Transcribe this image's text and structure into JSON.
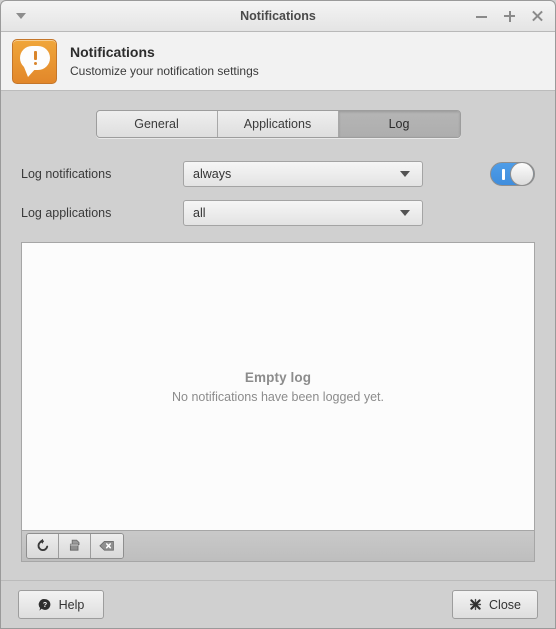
{
  "window": {
    "title": "Notifications",
    "menu_icon": "chevron-down-icon",
    "controls": {
      "minimize": "minimize-icon",
      "maximize": "maximize-icon",
      "close": "close-icon"
    }
  },
  "header": {
    "icon": "notification-bubble-icon",
    "title": "Notifications",
    "subtitle": "Customize your notification settings"
  },
  "tabs": [
    {
      "label": "General",
      "active": false
    },
    {
      "label": "Applications",
      "active": false
    },
    {
      "label": "Log",
      "active": true
    }
  ],
  "form": {
    "rows": [
      {
        "label": "Log notifications",
        "value": "always"
      },
      {
        "label": "Log applications",
        "value": "all"
      }
    ],
    "toggle": {
      "name": "log-enabled-toggle",
      "state": "on"
    }
  },
  "log": {
    "empty_title": "Empty log",
    "empty_subtitle": "No notifications have been logged yet.",
    "toolbar": [
      {
        "name": "refresh-button",
        "icon": "refresh-icon"
      },
      {
        "name": "copy-button",
        "icon": "copy-icon"
      },
      {
        "name": "clear-button",
        "icon": "backspace-clear-icon"
      }
    ]
  },
  "footer": {
    "help_label": "Help",
    "help_icon": "help-icon",
    "close_label": "Close",
    "close_icon": "close-x-icon"
  },
  "colors": {
    "accent": "#3f8ddd",
    "icon_orange": "#e2872a",
    "background": "#d0d0d0",
    "panel": "#fcfcfc",
    "muted_text": "#8c8c8c"
  }
}
